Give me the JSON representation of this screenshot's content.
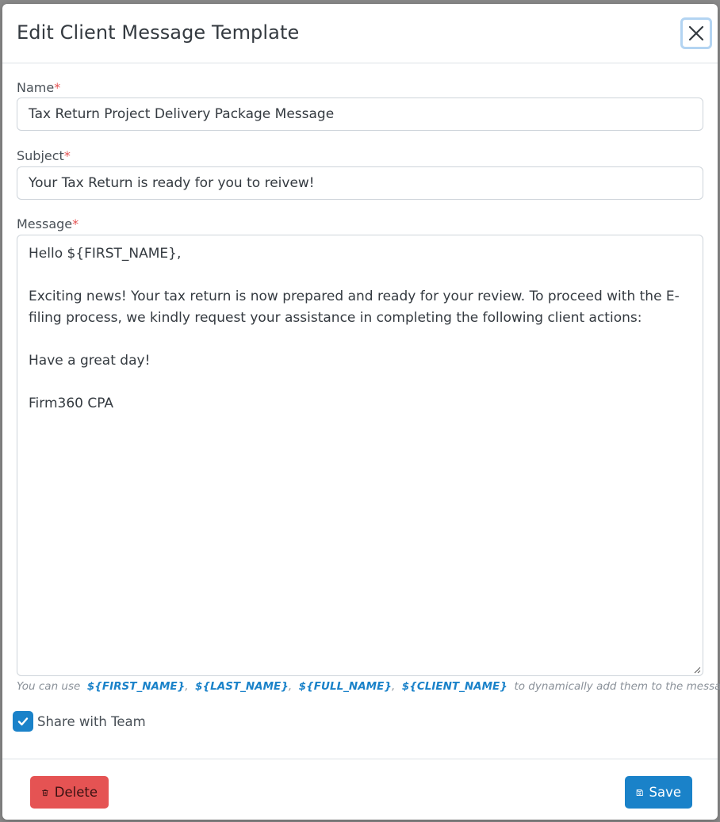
{
  "modal": {
    "title": "Edit Client Message Template"
  },
  "form": {
    "name": {
      "label": "Name",
      "required_mark": "*",
      "value": "Tax Return Project Delivery Package Message"
    },
    "subject": {
      "label": "Subject",
      "required_mark": "*",
      "value": "Your Tax Return is ready for you to reivew!"
    },
    "message": {
      "label": "Message",
      "required_mark": "*",
      "lines": [
        "Hello ${FIRST_NAME},",
        "",
        "Exciting news! Your tax return is now prepared and ready for your review. To proceed with the E-filing process, we kindly request your assistance in completing the following client actions:",
        "",
        "Have a great day!",
        "",
        "Firm360 CPA"
      ]
    },
    "hint": {
      "prefix": "You can use",
      "vars": [
        "${FIRST_NAME}",
        "${LAST_NAME}",
        "${FULL_NAME}",
        "${CLIENT_NAME}"
      ],
      "separator": ",",
      "suffix": "to dynamically add them to the message."
    },
    "share": {
      "label": "Share with Team",
      "checked": true
    }
  },
  "footer": {
    "delete_label": "Delete",
    "save_label": "Save"
  },
  "icons": {
    "close": "close-icon",
    "check": "check-icon",
    "trash": "trash-icon",
    "save": "floppy-disk-icon"
  },
  "colors": {
    "primary": "#1a82c9",
    "danger": "#e55353",
    "required": "#e55353"
  }
}
